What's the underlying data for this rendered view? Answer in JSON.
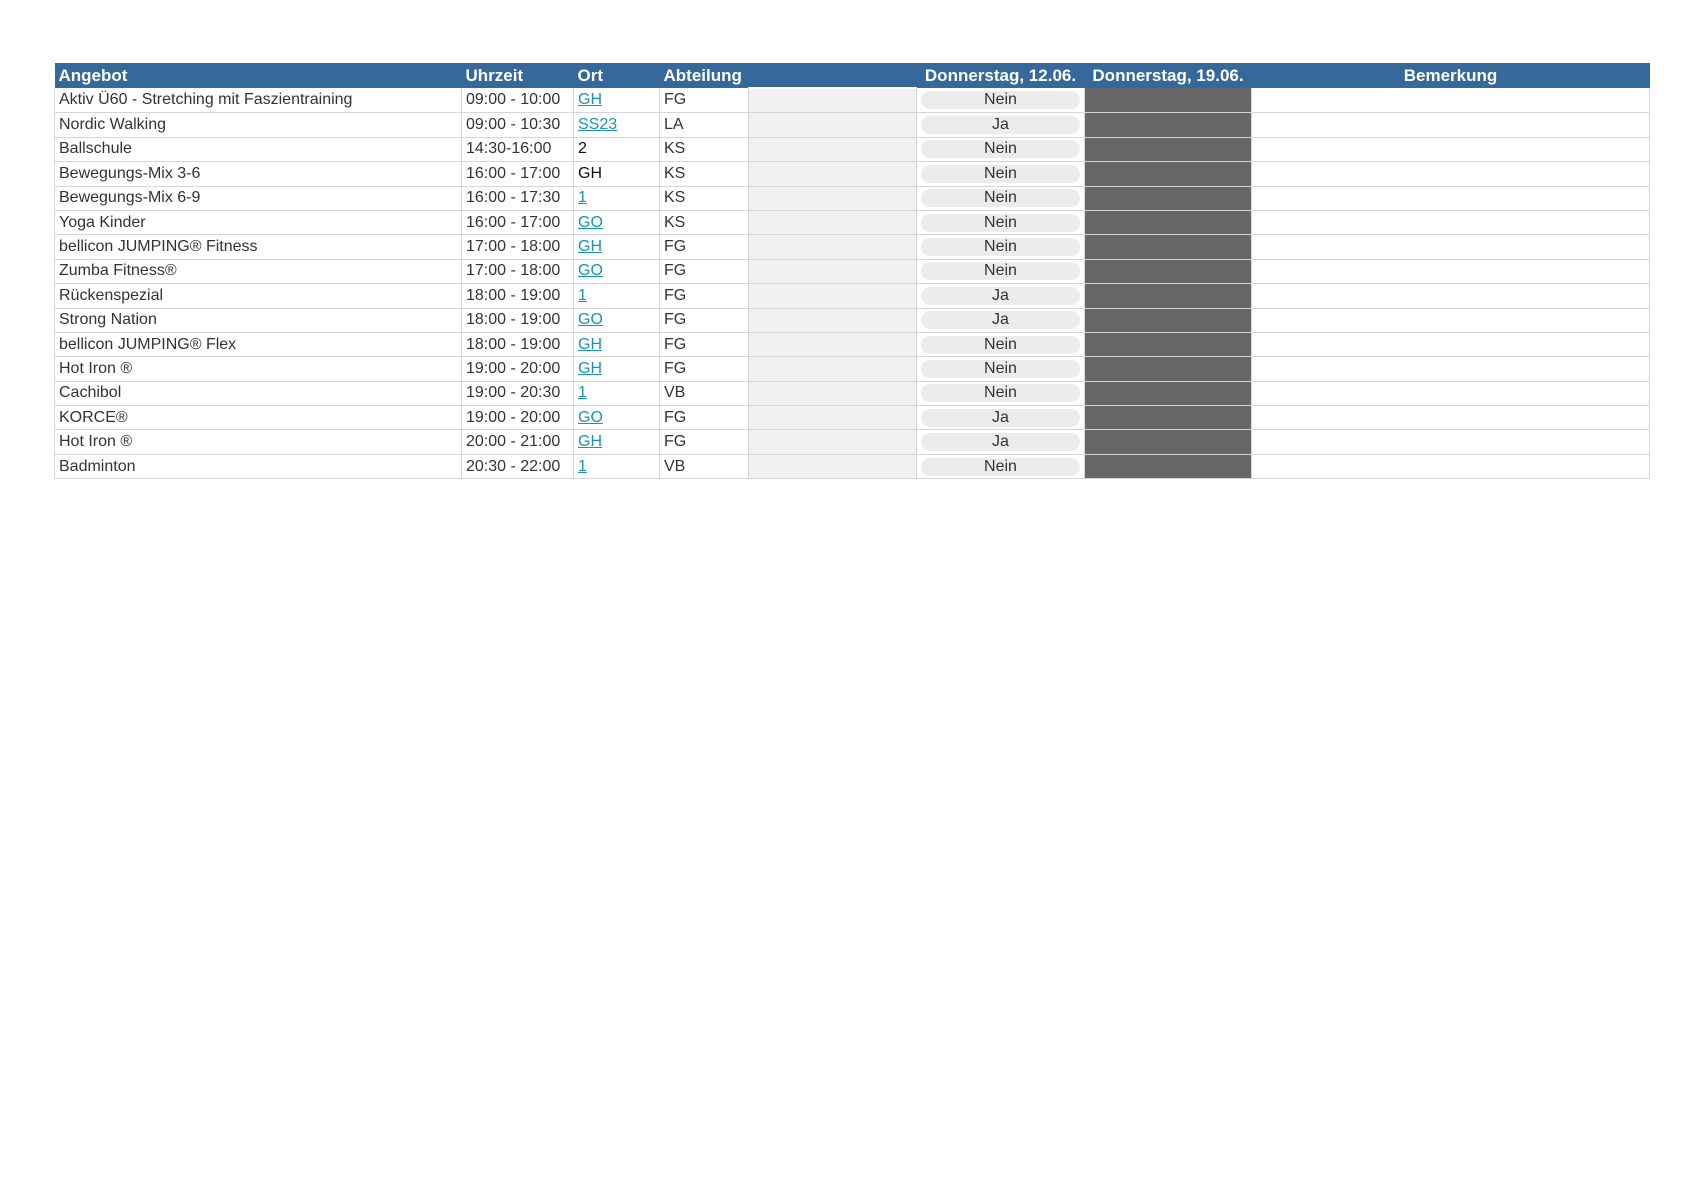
{
  "table": {
    "headers": {
      "angebot": "Angebot",
      "uhrzeit": "Uhrzeit",
      "ort": "Ort",
      "abteilung": "Abteilung",
      "blank": "",
      "date1": "Donnerstag, 12.06.",
      "date2": "Donnerstag, 19.06.",
      "bemerkung": "Bemerkung"
    },
    "colors": {
      "header_bg": "#36699b",
      "link": "#1a94b0",
      "dark_cell": "#666666",
      "pill_bg": "#ececec"
    },
    "rows": [
      {
        "angebot": "Aktiv Ü60 - Stretching mit Faszientraining",
        "uhrzeit": "09:00 - 10:00",
        "ort": "GH",
        "abteilung": "FG",
        "status": "Nein"
      },
      {
        "angebot": "Nordic Walking",
        "uhrzeit": "09:00 - 10:30",
        "ort": "SS23",
        "abteilung": "LA",
        "status": "Ja"
      },
      {
        "angebot": "Ballschule",
        "uhrzeit": "14:30-16:00",
        "ort": "2",
        "abteilung": "KS",
        "status": "Nein"
      },
      {
        "angebot": "Bewegungs-Mix 3-6",
        "uhrzeit": "16:00 - 17:00",
        "ort": "GH",
        "abteilung": "KS",
        "status": "Nein"
      },
      {
        "angebot": "Bewegungs-Mix 6-9",
        "uhrzeit": "16:00 - 17:30",
        "ort": "1",
        "abteilung": "KS",
        "status": "Nein"
      },
      {
        "angebot": "Yoga Kinder",
        "uhrzeit": "16:00 - 17:00",
        "ort": "GO",
        "abteilung": "KS",
        "status": "Nein"
      },
      {
        "angebot": "bellicon JUMPING® Fitness",
        "uhrzeit": "17:00 - 18:00",
        "ort": "GH",
        "abteilung": "FG",
        "status": "Nein"
      },
      {
        "angebot": "Zumba Fitness®",
        "uhrzeit": "17:00 - 18:00",
        "ort": "GO",
        "abteilung": "FG",
        "status": "Nein"
      },
      {
        "angebot": "Rückenspezial",
        "uhrzeit": "18:00 - 19:00",
        "ort": "1",
        "abteilung": "FG",
        "status": "Ja"
      },
      {
        "angebot": "Strong Nation",
        "uhrzeit": "18:00 - 19:00",
        "ort": "GO",
        "abteilung": "FG",
        "status": "Ja"
      },
      {
        "angebot": "bellicon JUMPING® Flex",
        "uhrzeit": "18:00 - 19:00",
        "ort": "GH",
        "abteilung": "FG",
        "status": "Nein"
      },
      {
        "angebot": "Hot Iron ®",
        "uhrzeit": "19:00 - 20:00",
        "ort": "GH",
        "abteilung": "FG",
        "status": "Nein"
      },
      {
        "angebot": "Cachibol",
        "uhrzeit": "19:00 - 20:30",
        "ort": "1",
        "abteilung": "VB",
        "status": "Nein"
      },
      {
        "angebot": "KORCE®",
        "uhrzeit": "19:00 - 20:00",
        "ort": "GO",
        "abteilung": "FG",
        "status": "Ja"
      },
      {
        "angebot": "Hot Iron ®",
        "uhrzeit": "20:00 - 21:00",
        "ort": "GH",
        "abteilung": "FG",
        "status": "Ja"
      },
      {
        "angebot": "Badminton",
        "uhrzeit": "20:30 - 22:00",
        "ort": "1",
        "abteilung": "VB",
        "status": "Nein"
      }
    ]
  }
}
